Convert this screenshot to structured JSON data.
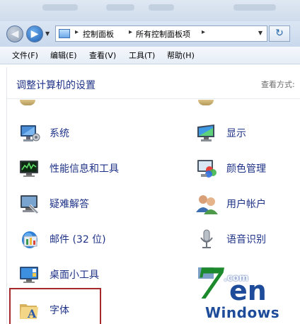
{
  "address": {
    "breadcrumbs": [
      "控制面板",
      "所有控制面板项"
    ]
  },
  "menu": [
    "文件(F)",
    "编辑(E)",
    "查看(V)",
    "工具(T)",
    "帮助(H)"
  ],
  "header": {
    "title": "调整计算机的设置",
    "view_by": "查看方式:"
  },
  "items_left": [
    {
      "label": "系统",
      "icon": "system-icon"
    },
    {
      "label": "性能信息和工具",
      "icon": "performance-icon"
    },
    {
      "label": "疑难解答",
      "icon": "troubleshooting-icon"
    },
    {
      "label": "邮件 (32 位)",
      "icon": "mail-icon"
    },
    {
      "label": "桌面小工具",
      "icon": "desktop-gadgets-icon"
    },
    {
      "label": "字体",
      "icon": "fonts-folder-icon"
    }
  ],
  "items_right": [
    {
      "label": "显示",
      "icon": "display-icon"
    },
    {
      "label": "颜色管理",
      "icon": "color-management-icon"
    },
    {
      "label": "用户帐户",
      "icon": "user-accounts-icon"
    },
    {
      "label": "语音识别",
      "icon": "speech-recognition-icon"
    }
  ],
  "watermark": {
    "seven": "7",
    "com": ".com",
    "en": "en",
    "windows": "Windows"
  }
}
